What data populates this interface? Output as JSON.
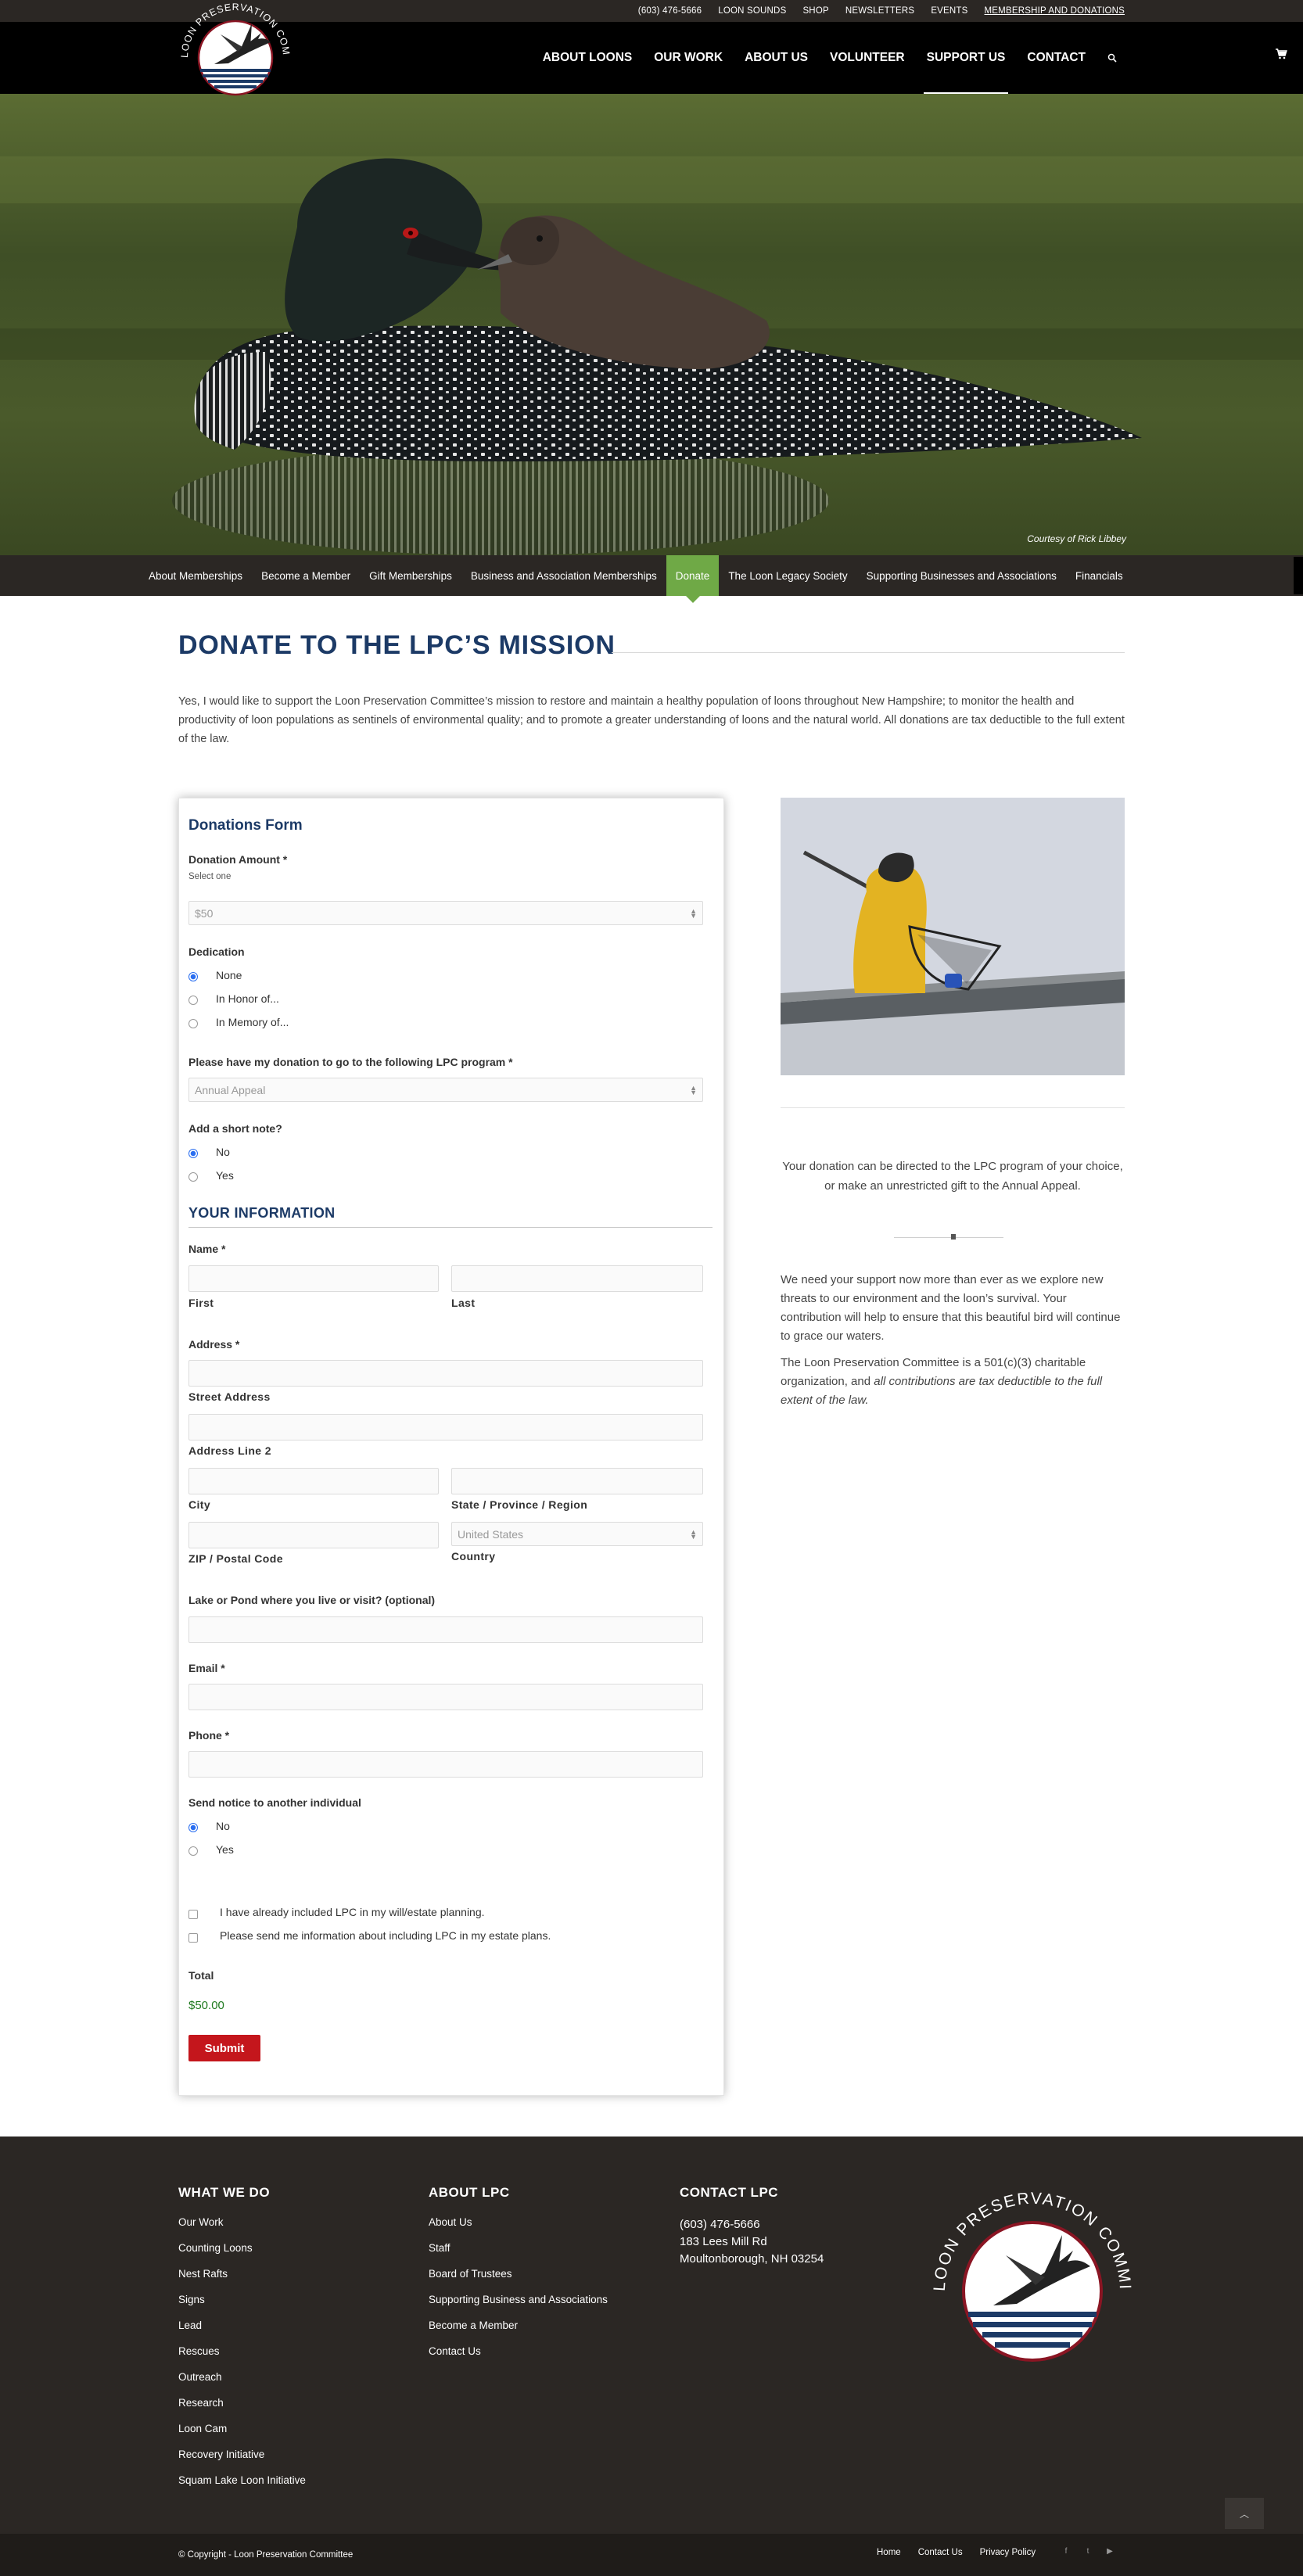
{
  "topbar": {
    "links": [
      "(603) 476-5666",
      "LOON SOUNDS",
      "SHOP",
      "NEWSLETTERS",
      "EVENTS",
      "MEMBERSHIP AND DONATIONS"
    ]
  },
  "logo": {
    "text": "LOON PRESERVATION COMMITTEE"
  },
  "mainnav": {
    "items": [
      "ABOUT LOONS",
      "OUR WORK",
      "ABOUT US",
      "VOLUNTEER",
      "SUPPORT US",
      "CONTACT"
    ],
    "active": "SUPPORT US",
    "search_icon": "search-icon",
    "cart_icon": "cart-icon"
  },
  "hero": {
    "credit": "Courtesy of Rick Libbey"
  },
  "subnav": {
    "items": [
      "About Memberships",
      "Become a Member",
      "Gift Memberships",
      "Business and Association Memberships",
      "Donate",
      "The Loon Legacy Society",
      "Supporting Businesses and Associations",
      "Financials"
    ],
    "active": "Donate"
  },
  "page": {
    "title": "DONATE TO THE LPC’S MISSION",
    "intro": "Yes, I would like to support the Loon Preservation Committee’s mission to restore and maintain a healthy population of loons throughout New Hampshire; to monitor the health and productivity of loon populations as sentinels of environmental quality; and to promote a greater understanding of loons and the natural world.  All donations are tax deductible to the full extent of the law."
  },
  "form": {
    "title": "Donations Form",
    "amount_label": "Donation Amount *",
    "amount_hint": "Select one",
    "amount_value": "$50",
    "dedication_label": "Dedication",
    "dedication_options": [
      "None",
      "In Honor of...",
      "In Memory of..."
    ],
    "dedication_selected": "None",
    "program_label": "Please have my donation to go to the following LPC program *",
    "program_value": "Annual Appeal",
    "note_label": "Add a short note?",
    "note_options": [
      "No",
      "Yes"
    ],
    "section_title": "YOUR INFORMATION",
    "name_label": "Name *",
    "first_label": "First",
    "last_label": "Last",
    "address_label": "Address *",
    "street_label": "Street Address",
    "line2_label": "Address Line 2",
    "city_label": "City",
    "state_label": "State / Province / Region",
    "zip_label": "ZIP / Postal Code",
    "country_label": "Country",
    "country_value": "United States",
    "lake_label": "Lake or Pond where you live or visit? (optional)",
    "email_label": "Email *",
    "phone_label": "Phone *",
    "notice_label": "Send notice to another individual",
    "notice_options": [
      "No",
      "Yes"
    ],
    "check1": "I have already included LPC in my will/estate planning.",
    "check2": "Please send me information about including LPC in my estate plans.",
    "total_label": "Total",
    "total_value": "$50.00",
    "submit": "Submit"
  },
  "sidebar": {
    "center_text": "Your donation can be directed to the LPC program of your choice, or make an unrestricted gift to the Annual Appeal.",
    "para1": "We need your support now more than ever as we explore new threats to our environment and the loon’s survival.  Your contribution will help to ensure that this beautiful bird will continue to grace our waters.",
    "para2_a": "The Loon Preservation Committee is a 501(c)(3) charitable organization, and ",
    "para2_b": "all contributions are tax deductible to the full extent of the law."
  },
  "footer": {
    "col1": {
      "title": "WHAT WE DO",
      "links": [
        "Our Work",
        "Counting Loons",
        "Nest Rafts",
        "Signs",
        "Lead",
        "Rescues",
        "Outreach",
        "Research",
        "Loon Cam",
        "Recovery Initiative",
        "Squam Lake Loon Initiative"
      ]
    },
    "col2": {
      "title": "ABOUT LPC",
      "links": [
        "About Us",
        "Staff",
        "Board of Trustees",
        "Supporting Business and Associations",
        "Become a Member",
        "Contact Us"
      ]
    },
    "col3": {
      "title": "CONTACT LPC",
      "phone": "(603) 476-5666",
      "street": "183 Lees Mill Rd",
      "city": "Moultonborough, NH 03254"
    },
    "logo_text": "LOON PRESERVATION COMMITTEE"
  },
  "bottombar": {
    "copyright": "© Copyright - Loon Preservation Committee",
    "links": [
      "Home",
      "Contact Us",
      "Privacy Policy"
    ],
    "social_icons": [
      "facebook-icon",
      "twitter-icon",
      "youtube-icon"
    ]
  },
  "colors": {
    "navy": "#1c3a66",
    "green": "#6fa946",
    "red": "#c4161c",
    "dark": "#2b2724"
  }
}
